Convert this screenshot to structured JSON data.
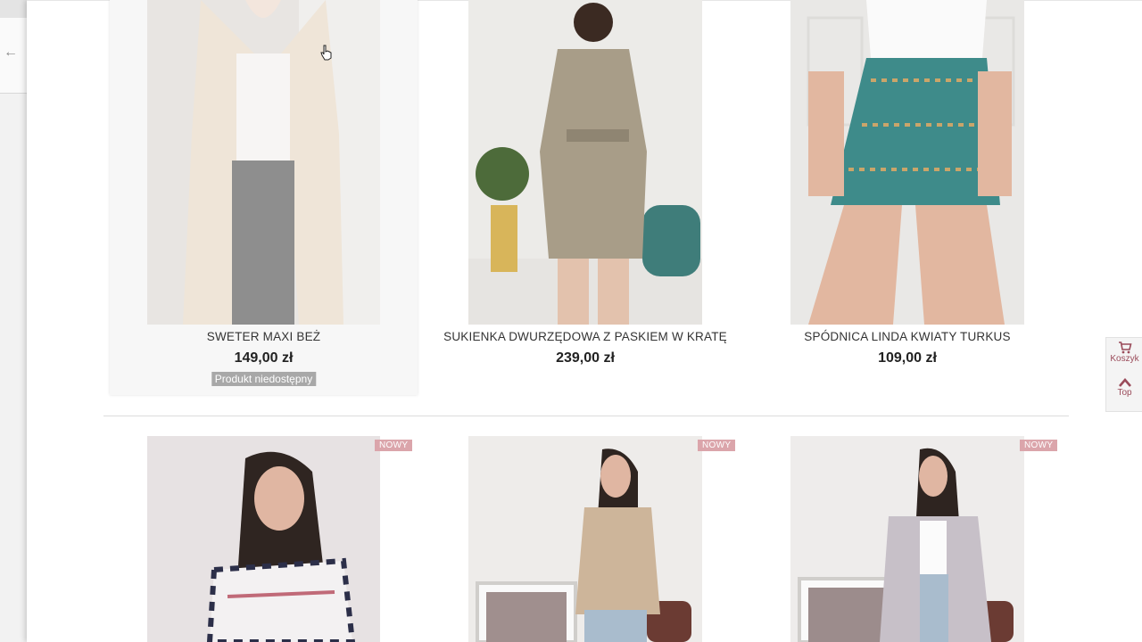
{
  "products_row1": [
    {
      "name": "SWETER MAXI BEŻ",
      "price": "149,00 zł",
      "status": "Produkt niedostępny"
    },
    {
      "name": "SUKIENKA DWURZĘDOWA Z PASKIEM W KRATĘ",
      "price": "239,00 zł"
    },
    {
      "name": "SPÓDNICA LINDA KWIATY TURKUS",
      "price": "109,00 zł"
    }
  ],
  "products_row2": [
    {
      "badge": "NOWY"
    },
    {
      "badge": "NOWY"
    },
    {
      "badge": "NOWY"
    }
  ],
  "side": {
    "cart_label": "Koszyk",
    "top_label": "Top"
  },
  "colors": {
    "badge": "#dba5ab",
    "accent": "#9a4b5a",
    "unavailable": "#a8a8a8"
  }
}
